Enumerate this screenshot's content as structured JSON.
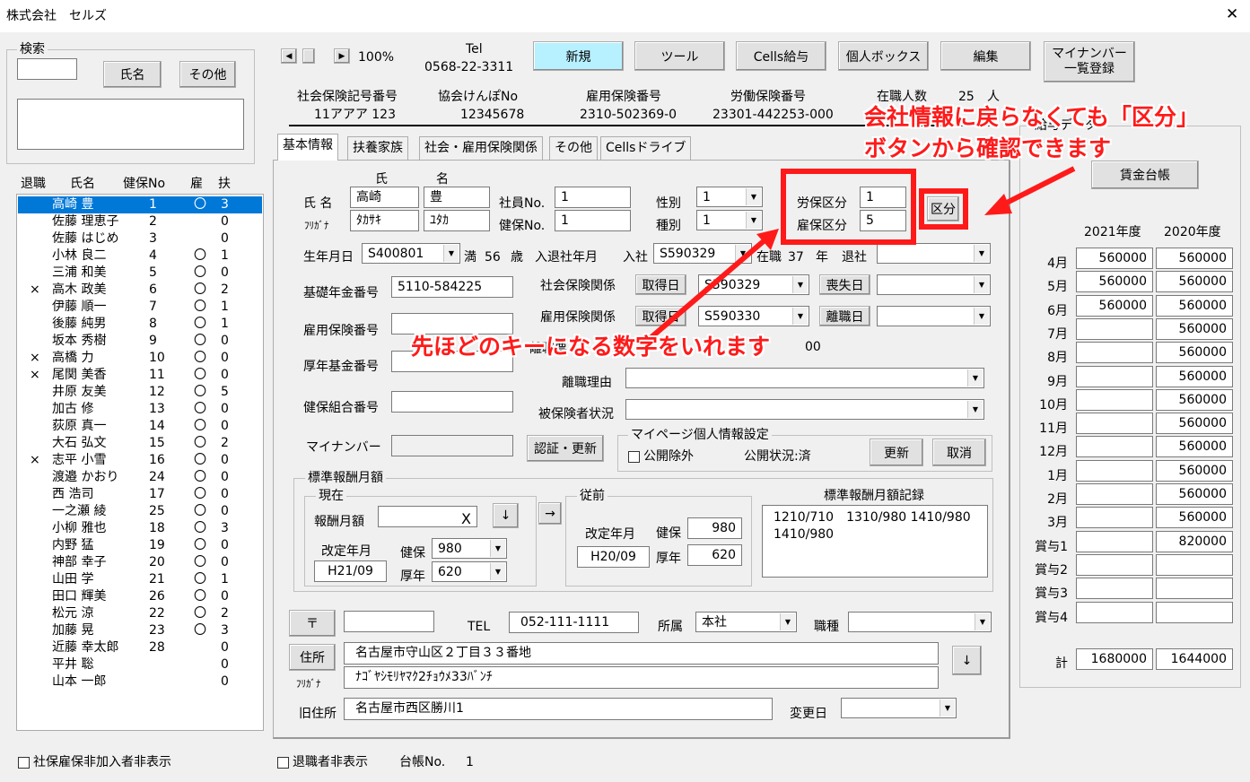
{
  "window": {
    "title": "株式会社　セルズ",
    "close": "✕"
  },
  "search": {
    "label": "検索",
    "name_button": "氏名",
    "other_button": "その他"
  },
  "list": {
    "headers": {
      "retire": "退職",
      "name": "氏名",
      "kenpo_no": "健保No",
      "koyo": "雇",
      "fuyo": "扶"
    },
    "rows": [
      {
        "retire": "",
        "name": "高崎 豊",
        "no": "1",
        "koyo": "〇",
        "fuyo": "3"
      },
      {
        "retire": "",
        "name": "佐藤 理恵子",
        "no": "2",
        "koyo": "",
        "fuyo": "0"
      },
      {
        "retire": "",
        "name": "佐藤 はじめ",
        "no": "3",
        "koyo": "",
        "fuyo": "0"
      },
      {
        "retire": "",
        "name": "小林 良二",
        "no": "4",
        "koyo": "〇",
        "fuyo": "1"
      },
      {
        "retire": "",
        "name": "三浦 和美",
        "no": "5",
        "koyo": "〇",
        "fuyo": "0"
      },
      {
        "retire": "×",
        "name": "高木 政美",
        "no": "6",
        "koyo": "〇",
        "fuyo": "2"
      },
      {
        "retire": "",
        "name": "伊藤 順一",
        "no": "7",
        "koyo": "〇",
        "fuyo": "1"
      },
      {
        "retire": "",
        "name": "後藤 純男",
        "no": "8",
        "koyo": "〇",
        "fuyo": "1"
      },
      {
        "retire": "",
        "name": "坂本 秀樹",
        "no": "9",
        "koyo": "〇",
        "fuyo": "0"
      },
      {
        "retire": "×",
        "name": "高橋 力",
        "no": "10",
        "koyo": "〇",
        "fuyo": "0"
      },
      {
        "retire": "×",
        "name": "尾関 美香",
        "no": "11",
        "koyo": "〇",
        "fuyo": "0"
      },
      {
        "retire": "",
        "name": "井原 友美",
        "no": "12",
        "koyo": "〇",
        "fuyo": "5"
      },
      {
        "retire": "",
        "name": "加古 修",
        "no": "13",
        "koyo": "〇",
        "fuyo": "0"
      },
      {
        "retire": "",
        "name": "荻原 真一",
        "no": "14",
        "koyo": "〇",
        "fuyo": "0"
      },
      {
        "retire": "",
        "name": "大石 弘文",
        "no": "15",
        "koyo": "〇",
        "fuyo": "2"
      },
      {
        "retire": "×",
        "name": "志平 小雪",
        "no": "16",
        "koyo": "〇",
        "fuyo": "0"
      },
      {
        "retire": "",
        "name": "渡邉 かおり",
        "no": "24",
        "koyo": "〇",
        "fuyo": "0"
      },
      {
        "retire": "",
        "name": "西 浩司",
        "no": "17",
        "koyo": "〇",
        "fuyo": "0"
      },
      {
        "retire": "",
        "name": "一之瀬 綾",
        "no": "25",
        "koyo": "〇",
        "fuyo": "0"
      },
      {
        "retire": "",
        "name": "小柳 雅也",
        "no": "18",
        "koyo": "〇",
        "fuyo": "3"
      },
      {
        "retire": "",
        "name": "内野 猛",
        "no": "19",
        "koyo": "〇",
        "fuyo": "0"
      },
      {
        "retire": "",
        "name": "神部 幸子",
        "no": "20",
        "koyo": "〇",
        "fuyo": "0"
      },
      {
        "retire": "",
        "name": "山田 学",
        "no": "21",
        "koyo": "〇",
        "fuyo": "1"
      },
      {
        "retire": "",
        "name": "田口 輝美",
        "no": "26",
        "koyo": "〇",
        "fuyo": "0"
      },
      {
        "retire": "",
        "name": "松元 涼",
        "no": "22",
        "koyo": "〇",
        "fuyo": "2"
      },
      {
        "retire": "",
        "name": "加藤 晃",
        "no": "23",
        "koyo": "〇",
        "fuyo": "3"
      },
      {
        "retire": "",
        "name": "近藤 幸太郎",
        "no": "28",
        "koyo": "",
        "fuyo": "0"
      },
      {
        "retire": "",
        "name": "平井 聡",
        "no": "",
        "koyo": "",
        "fuyo": "0"
      },
      {
        "retire": "",
        "name": "山本 一郎",
        "no": "",
        "koyo": "",
        "fuyo": "0"
      }
    ]
  },
  "footer": {
    "hide_nonmember": "社保雇保非加入者非表示",
    "hide_retired": "退職者非表示",
    "ledger_label": "台帳No.",
    "ledger_no": "1"
  },
  "toolbar": {
    "zoom": "100%",
    "tel_label": "Tel",
    "tel": "0568-22-3311",
    "new": "新規",
    "tool": "ツール",
    "cells_salary": "Cells給与",
    "personal_box": "個人ボックス",
    "edit": "編集",
    "mynumber_1": "マイナンバー",
    "mynumber_2": "一覧登録"
  },
  "company": {
    "shaho_label": "社会保険記号番号",
    "shaho": "11アアア 123",
    "kyokai_label": "協会けんぽNo",
    "kyokai": "12345678",
    "koyo_label": "雇用保険番号",
    "koyo": "2310-502369-0",
    "rodo_label": "労働保険番号",
    "rodo": "23301-442253-000",
    "count_label": "在職人数",
    "count": "25",
    "count_unit": "人"
  },
  "tabs": [
    "基本情報",
    "扶養家族",
    "社会・雇用保険関係",
    "その他",
    "Cellsドライブ"
  ],
  "form": {
    "sei_label": "氏",
    "mei_label": "名",
    "name_label": "氏 名",
    "sei": "高崎",
    "mei": "豊",
    "kana_label": "ﾌﾘｶﾞﾅ",
    "sei_kana": "ﾀｶｻｷ",
    "mei_kana": "ﾕﾀｶ",
    "emp_no_label": "社員No.",
    "emp_no": "1",
    "kenpo_no_label": "健保No.",
    "kenpo_no": "1",
    "gender_label": "性別",
    "gender": "1",
    "type_label": "種別",
    "type": "1",
    "rouho_label": "労保区分",
    "rouho": "1",
    "koyoho_label": "雇保区分",
    "koyoho": "5",
    "kubun_button": "区分",
    "birth_label": "生年月日",
    "birth": "S400801",
    "age_prefix": "満",
    "age": "56",
    "age_unit": "歳",
    "join_label": "入退社年月",
    "join_in": "入社",
    "join_date": "S590329",
    "tenure_label": "在職",
    "tenure": "37",
    "tenure_unit": "年",
    "leave_label": "退社",
    "leave_date": "",
    "pension_label": "基礎年金番号",
    "pension": "5110-584225",
    "shaho_rel_label": "社会保険関係",
    "shutoku": "取得日",
    "shaho_date": "S590329",
    "soshitsu": "喪失日",
    "koyo_no_label": "雇用保険番号",
    "koyo_rel_label": "雇用保険関係",
    "koyo_date": "S590330",
    "rishoku": "離職日",
    "fund_label": "厚年基金番号",
    "hidden_label": "離職票",
    "hidden_val": "00",
    "rishoku_reason_label": "離職理由",
    "kenpo_kumiai_label": "健保組合番号",
    "hihokensha_label": "被保険者状況",
    "mynumber_label": "マイナンバー",
    "auth_button": "認証・更新",
    "mypage_group": "マイページ個人情報設定",
    "exclude_label": "公開除外",
    "status": "公開状況:済",
    "update": "更新",
    "cancel": "取消"
  },
  "hyojun": {
    "group": "標準報酬月額",
    "current": "現在",
    "reward_label": "報酬月額",
    "reward_x": "X",
    "down": "↓",
    "arrow": "→",
    "kaitei_label": "改定年月",
    "kaitei": "H21/09",
    "kenpo_label": "健保",
    "kenpo": "980",
    "kounen_label": "厚年",
    "kounen": "620",
    "prev": "従前",
    "prev_kaitei_label": "改定年月",
    "prev_kaitei": "H20/09",
    "prev_kenpo_label": "健保",
    "prev_kenpo": "980",
    "prev_kounen_label": "厚年",
    "prev_kounen": "620",
    "record_label": "標準報酬月額記録",
    "record_1": "1210/710　1310/980 1410/980",
    "record_2": "1410/980"
  },
  "address": {
    "zip_button": "〒",
    "tel_label": "TEL",
    "tel": "052-111-1111",
    "dept_label": "所属",
    "dept": "本社",
    "job_label": "職種",
    "address_button": "住所",
    "address": "名古屋市守山区２丁目３３番地",
    "kana_label": "ﾌﾘｶﾞﾅ",
    "kana": "ﾅｺﾞﾔｼﾓﾘﾔﾏｸ2ﾁｮｳﾒ33ﾊﾞﾝﾁ",
    "down": "↓",
    "old_label": "旧住所",
    "old": "名古屋市西区勝川1",
    "change_label": "変更日"
  },
  "salary": {
    "group": "給与データ",
    "ledger_button": "賃金台帳",
    "col1": "2021年度",
    "col2": "2020年度",
    "rows": [
      {
        "label": "4月",
        "a": "560000",
        "b": "560000"
      },
      {
        "label": "5月",
        "a": "560000",
        "b": "560000"
      },
      {
        "label": "6月",
        "a": "560000",
        "b": "560000"
      },
      {
        "label": "7月",
        "a": "",
        "b": "560000"
      },
      {
        "label": "8月",
        "a": "",
        "b": "560000"
      },
      {
        "label": "9月",
        "a": "",
        "b": "560000"
      },
      {
        "label": "10月",
        "a": "",
        "b": "560000"
      },
      {
        "label": "11月",
        "a": "",
        "b": "560000"
      },
      {
        "label": "12月",
        "a": "",
        "b": "560000"
      },
      {
        "label": "1月",
        "a": "",
        "b": "560000"
      },
      {
        "label": "2月",
        "a": "",
        "b": "560000"
      },
      {
        "label": "3月",
        "a": "",
        "b": "560000"
      },
      {
        "label": "賞与1",
        "a": "",
        "b": "820000"
      },
      {
        "label": "賞与2",
        "a": "",
        "b": ""
      },
      {
        "label": "賞与3",
        "a": "",
        "b": ""
      },
      {
        "label": "賞与4",
        "a": "",
        "b": ""
      }
    ],
    "total_label": "計",
    "total_a": "1680000",
    "total_b": "1644000"
  },
  "annotations": {
    "callout_1": "会社情報に戻らなくても「区分」",
    "callout_2": "ボタンから確認できます",
    "callout_3": "先ほどのキーになる数字をいれます",
    "color": "#ff1a1a"
  }
}
